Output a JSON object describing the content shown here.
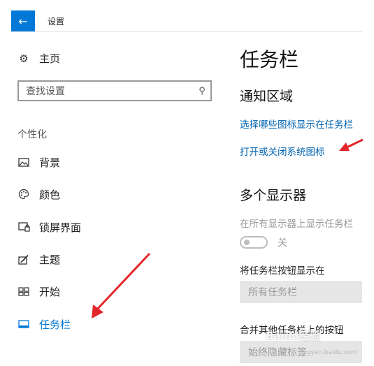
{
  "window": {
    "title": "设置",
    "back_icon": "back-arrow-icon",
    "accent": "#0078d7"
  },
  "sidebar": {
    "home_label": "主页",
    "search_placeholder": "查找设置",
    "section_label": "个性化",
    "items": [
      {
        "label": "背景",
        "icon": "picture-icon"
      },
      {
        "label": "颜色",
        "icon": "palette-icon"
      },
      {
        "label": "锁屏界面",
        "icon": "lock-screen-icon"
      },
      {
        "label": "主题",
        "icon": "theme-brush-icon"
      },
      {
        "label": "开始",
        "icon": "start-tiles-icon"
      },
      {
        "label": "任务栏",
        "icon": "taskbar-icon",
        "active": true
      }
    ]
  },
  "main": {
    "title": "任务栏",
    "notification_area": {
      "heading": "通知区域",
      "link_select_icons": "选择哪些图标显示在任务栏",
      "link_system_icons": "打开或关闭系统图标"
    },
    "multi_display": {
      "heading": "多个显示器",
      "show_on_all_label": "在所有显示器上显示任务栏",
      "toggle_state": "关",
      "show_buttons_label": "将任务栏按钮显示在",
      "show_buttons_value": "所有任务栏",
      "combine_label": "合并其他任务栏上的按钮",
      "combine_value": "始终隐藏标签"
    }
  },
  "watermark": {
    "text": "Baidu经验",
    "sub": "jingyan.baidu.com"
  },
  "annotation_color": "#e3262b"
}
